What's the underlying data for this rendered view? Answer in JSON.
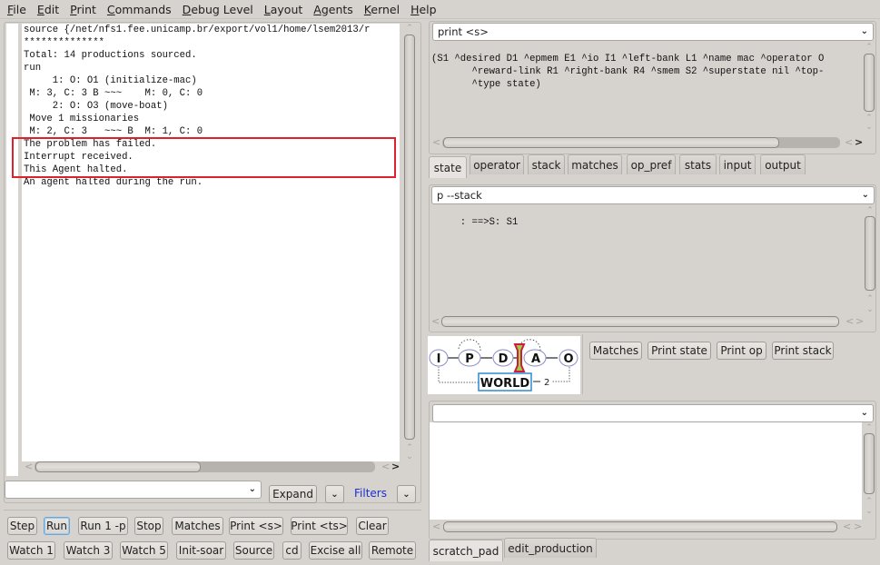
{
  "menubar": {
    "items": [
      {
        "label": "File",
        "mnemonic": "F",
        "rest": "ile"
      },
      {
        "label": "Edit",
        "mnemonic": "E",
        "rest": "dit"
      },
      {
        "label": "Print",
        "mnemonic": "P",
        "rest": "rint"
      },
      {
        "label": "Commands",
        "mnemonic": "C",
        "rest": "ommands"
      },
      {
        "label": "Debug Level",
        "mnemonic": "D",
        "rest": "ebug Level"
      },
      {
        "label": "Layout",
        "mnemonic": "L",
        "rest": "ayout"
      },
      {
        "label": "Agents",
        "mnemonic": "A",
        "rest": "gents"
      },
      {
        "label": "Kernel",
        "mnemonic": "K",
        "rest": "ernel"
      },
      {
        "label": "Help",
        "mnemonic": "H",
        "rest": "elp"
      }
    ]
  },
  "console": {
    "lines": [
      "source {/net/nfs1.fee.unicamp.br/export/vol1/home/lsem2013/r",
      "**************",
      "Total: 14 productions sourced.",
      "run",
      "     1: O: O1 (initialize-mac)",
      " M: 3, C: 3 B ~~~    M: 0, C: 0",
      "     2: O: O3 (move-boat)",
      " Move 1 missionaries",
      " M: 2, C: 3   ~~~ B  M: 1, C: 0",
      "The problem has failed.",
      "Interrupt received.",
      "This Agent halted.",
      "",
      "An agent halted during the run."
    ],
    "highlight_color": "#e0202c"
  },
  "command_bar": {
    "input_value": "",
    "expand_label": "Expand",
    "filters_label": "Filters"
  },
  "buttons_row1": [
    "Step",
    "Run",
    "Run 1 -p",
    "Stop",
    "Matches",
    "Print <s>",
    "Print <ts>",
    "Clear"
  ],
  "buttons_row2": [
    "Watch 1",
    "Watch 3",
    "Watch 5",
    "Init-soar",
    "Source",
    "cd",
    "Excise all",
    "Remote"
  ],
  "focused_button": "Run",
  "state_panel": {
    "command": "print <s>",
    "lines": [
      "(S1 ^desired D1 ^epmem E1 ^io I1 ^left-bank L1 ^name mac ^operator O",
      "       ^reward-link R1 ^right-bank R4 ^smem S2 ^superstate nil ^top-",
      "       ^type state)"
    ],
    "tabs": [
      "state",
      "operator",
      "stack",
      "matches",
      "op_pref",
      "stats",
      "input",
      "output"
    ],
    "active_tab": "state"
  },
  "stack_panel": {
    "command": "p --stack",
    "lines": [
      "     : ==>S: S1"
    ]
  },
  "cycle_diagram": {
    "nodes": [
      "I",
      "P",
      "D",
      "A",
      "O"
    ],
    "world_label": "WORLD",
    "loop_label": "2",
    "highlight_colors": {
      "stop_marker": "#d01c3c",
      "stop_fill": "#9ad04a",
      "world_border": "#2a8ad0"
    }
  },
  "quick_buttons": [
    "Matches",
    "Print state",
    "Print op",
    "Print stack"
  ],
  "scratch_panel": {
    "command": "",
    "tabs": [
      "scratch_pad",
      "edit_production"
    ],
    "active_tab": "scratch_pad"
  }
}
